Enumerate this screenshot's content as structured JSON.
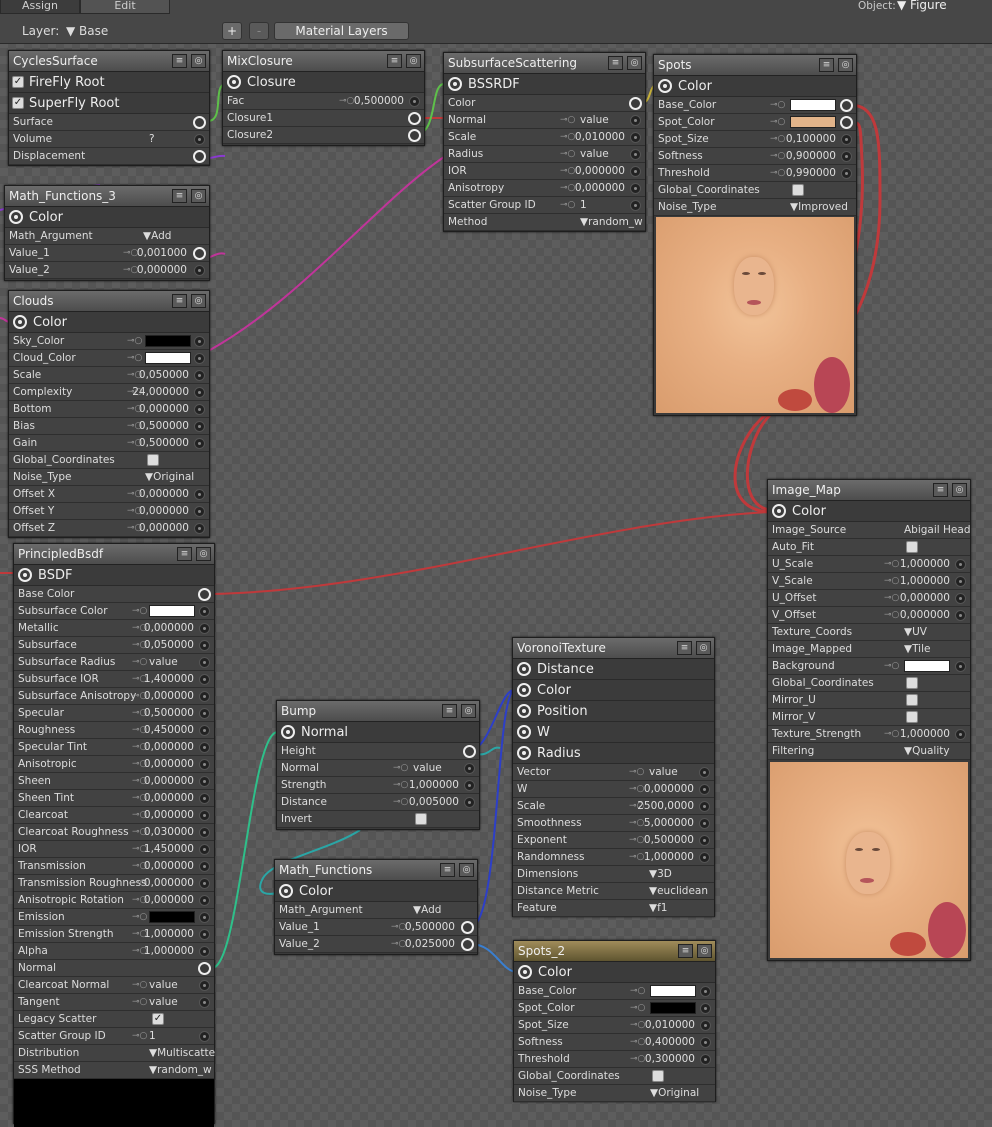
{
  "topbar": {
    "tab_assign": "Assign",
    "tab_edit": "Edit",
    "layer_label": "Layer:",
    "layer_value": "Base",
    "plus": "+",
    "minus": "-",
    "material_layers": "Material Layers",
    "object_label": "Object:",
    "object_value": "Figure"
  },
  "cycles": {
    "title": "CyclesSurface",
    "firefly": "FireFly Root",
    "superfly": "SuperFly Root",
    "surface": "Surface",
    "volume": "Volume",
    "volume_val": "?",
    "displacement": "Displacement"
  },
  "mix": {
    "title": "MixClosure",
    "out": "Closure",
    "fac": "Fac",
    "fac_val": "0,500000",
    "c1": "Closure1",
    "c2": "Closure2"
  },
  "sss": {
    "title": "SubsurfaceScattering",
    "out": "BSSRDF",
    "rows": [
      {
        "l": "Color",
        "v": ""
      },
      {
        "l": "Normal",
        "v": "value"
      },
      {
        "l": "Scale",
        "v": "0,010000"
      },
      {
        "l": "Radius",
        "v": "value"
      },
      {
        "l": "IOR",
        "v": "0,000000"
      },
      {
        "l": "Anisotropy",
        "v": "0,000000"
      },
      {
        "l": "Scatter Group ID",
        "v": "1"
      },
      {
        "l": "Method",
        "v": "random_w"
      }
    ]
  },
  "spots": {
    "title": "Spots",
    "out": "Color",
    "rows": [
      {
        "l": "Base_Color",
        "v": ""
      },
      {
        "l": "Spot_Color",
        "v": ""
      },
      {
        "l": "Spot_Size",
        "v": "0,100000"
      },
      {
        "l": "Softness",
        "v": "0,900000"
      },
      {
        "l": "Threshold",
        "v": "0,990000"
      },
      {
        "l": "Global_Coordinates",
        "v": ""
      },
      {
        "l": "Noise_Type",
        "v": "Improved"
      }
    ]
  },
  "math3": {
    "title": "Math_Functions_3",
    "out": "Color",
    "arg": "Math_Argument",
    "arg_val": "Add",
    "v1": "Value_1",
    "v1_val": "0,001000",
    "v2": "Value_2",
    "v2_val": "0,000000"
  },
  "clouds": {
    "title": "Clouds",
    "out": "Color",
    "rows": [
      {
        "l": "Sky_Color",
        "v": ""
      },
      {
        "l": "Cloud_Color",
        "v": ""
      },
      {
        "l": "Scale",
        "v": "0,050000"
      },
      {
        "l": "Complexity",
        "v": "24,000000"
      },
      {
        "l": "Bottom",
        "v": "0,000000"
      },
      {
        "l": "Bias",
        "v": "0,500000"
      },
      {
        "l": "Gain",
        "v": "0,500000"
      },
      {
        "l": "Global_Coordinates",
        "v": ""
      },
      {
        "l": "Noise_Type",
        "v": "Original"
      },
      {
        "l": "Offset X",
        "v": "0,000000"
      },
      {
        "l": "Offset Y",
        "v": "0,000000"
      },
      {
        "l": "Offset Z",
        "v": "0,000000"
      }
    ]
  },
  "principled": {
    "title": "PrincipledBsdf",
    "out": "BSDF",
    "rows": [
      {
        "l": "Base Color",
        "v": ""
      },
      {
        "l": "Subsurface Color",
        "v": ""
      },
      {
        "l": "Metallic",
        "v": "0,000000"
      },
      {
        "l": "Subsurface",
        "v": "0,050000"
      },
      {
        "l": "Subsurface Radius",
        "v": "value"
      },
      {
        "l": "Subsurface IOR",
        "v": "1,400000"
      },
      {
        "l": "Subsurface Anisotropy",
        "v": "0,000000"
      },
      {
        "l": "Specular",
        "v": "0,500000"
      },
      {
        "l": "Roughness",
        "v": "0,450000"
      },
      {
        "l": "Specular Tint",
        "v": "0,000000"
      },
      {
        "l": "Anisotropic",
        "v": "0,000000"
      },
      {
        "l": "Sheen",
        "v": "0,000000"
      },
      {
        "l": "Sheen Tint",
        "v": "0,000000"
      },
      {
        "l": "Clearcoat",
        "v": "0,000000"
      },
      {
        "l": "Clearcoat Roughness",
        "v": "0,030000"
      },
      {
        "l": "IOR",
        "v": "1,450000"
      },
      {
        "l": "Transmission",
        "v": "0,000000"
      },
      {
        "l": "Transmission Roughness",
        "v": "0,000000"
      },
      {
        "l": "Anisotropic Rotation",
        "v": "0,000000"
      },
      {
        "l": "Emission",
        "v": ""
      },
      {
        "l": "Emission Strength",
        "v": "1,000000"
      },
      {
        "l": "Alpha",
        "v": "1,000000"
      },
      {
        "l": "Normal",
        "v": ""
      },
      {
        "l": "Clearcoat Normal",
        "v": "value"
      },
      {
        "l": "Tangent",
        "v": "value"
      },
      {
        "l": "Legacy Scatter",
        "v": ""
      },
      {
        "l": "Scatter Group ID",
        "v": "1"
      },
      {
        "l": "Distribution",
        "v": "Multiscatte"
      },
      {
        "l": "SSS Method",
        "v": "random_w"
      }
    ]
  },
  "bump": {
    "title": "Bump",
    "out": "Normal",
    "rows": [
      {
        "l": "Height",
        "v": ""
      },
      {
        "l": "Normal",
        "v": "value"
      },
      {
        "l": "Strength",
        "v": "1,000000"
      },
      {
        "l": "Distance",
        "v": "0,005000"
      },
      {
        "l": "Invert",
        "v": ""
      }
    ]
  },
  "mathf": {
    "title": "Math_Functions",
    "out": "Color",
    "arg": "Math_Argument",
    "arg_val": "Add",
    "v1": "Value_1",
    "v1_val": "0,500000",
    "v2": "Value_2",
    "v2_val": "0,025000"
  },
  "voronoi": {
    "title": "VoronoiTexture",
    "outs": [
      "Distance",
      "Color",
      "Position",
      "W",
      "Radius"
    ],
    "rows": [
      {
        "l": "Vector",
        "v": "value"
      },
      {
        "l": "W",
        "v": "0,000000"
      },
      {
        "l": "Scale",
        "v": "2500,0000"
      },
      {
        "l": "Smoothness",
        "v": "5,000000"
      },
      {
        "l": "Exponent",
        "v": "0,500000"
      },
      {
        "l": "Randomness",
        "v": "1,000000"
      },
      {
        "l": "Dimensions",
        "v": "3D"
      },
      {
        "l": "Distance Metric",
        "v": "euclidean"
      },
      {
        "l": "Feature",
        "v": "f1"
      }
    ]
  },
  "spots2": {
    "title": "Spots_2",
    "out": "Color",
    "rows": [
      {
        "l": "Base_Color",
        "v": ""
      },
      {
        "l": "Spot_Color",
        "v": ""
      },
      {
        "l": "Spot_Size",
        "v": "0,010000"
      },
      {
        "l": "Softness",
        "v": "0,400000"
      },
      {
        "l": "Threshold",
        "v": "0,300000"
      },
      {
        "l": "Global_Coordinates",
        "v": ""
      },
      {
        "l": "Noise_Type",
        "v": "Original"
      }
    ]
  },
  "imagemap": {
    "title": "Image_Map",
    "out": "Color",
    "rows": [
      {
        "l": "Image_Source",
        "v": "Abigail Head"
      },
      {
        "l": "Auto_Fit",
        "v": ""
      },
      {
        "l": "U_Scale",
        "v": "1,000000"
      },
      {
        "l": "V_Scale",
        "v": "1,000000"
      },
      {
        "l": "U_Offset",
        "v": "0,000000"
      },
      {
        "l": "V_Offset",
        "v": "0,000000"
      },
      {
        "l": "Texture_Coords",
        "v": "UV"
      },
      {
        "l": "Image_Mapped",
        "v": "Tile"
      },
      {
        "l": "Background",
        "v": ""
      },
      {
        "l": "Global_Coordinates",
        "v": ""
      },
      {
        "l": "Mirror_U",
        "v": ""
      },
      {
        "l": "Mirror_V",
        "v": ""
      },
      {
        "l": "Texture_Strength",
        "v": "1,000000"
      },
      {
        "l": "Filtering",
        "v": "Quality"
      }
    ]
  },
  "colors": {
    "wire_red": "#c0393b",
    "wire_green": "#5ec04a",
    "wire_magenta": "#c0359a",
    "wire_purple": "#8a3ad0",
    "wire_blue": "#2d3fc8",
    "wire_teal": "#2aa6a6",
    "wire_lightblue": "#3a7fd0",
    "spot_color": "#e2b48a"
  }
}
